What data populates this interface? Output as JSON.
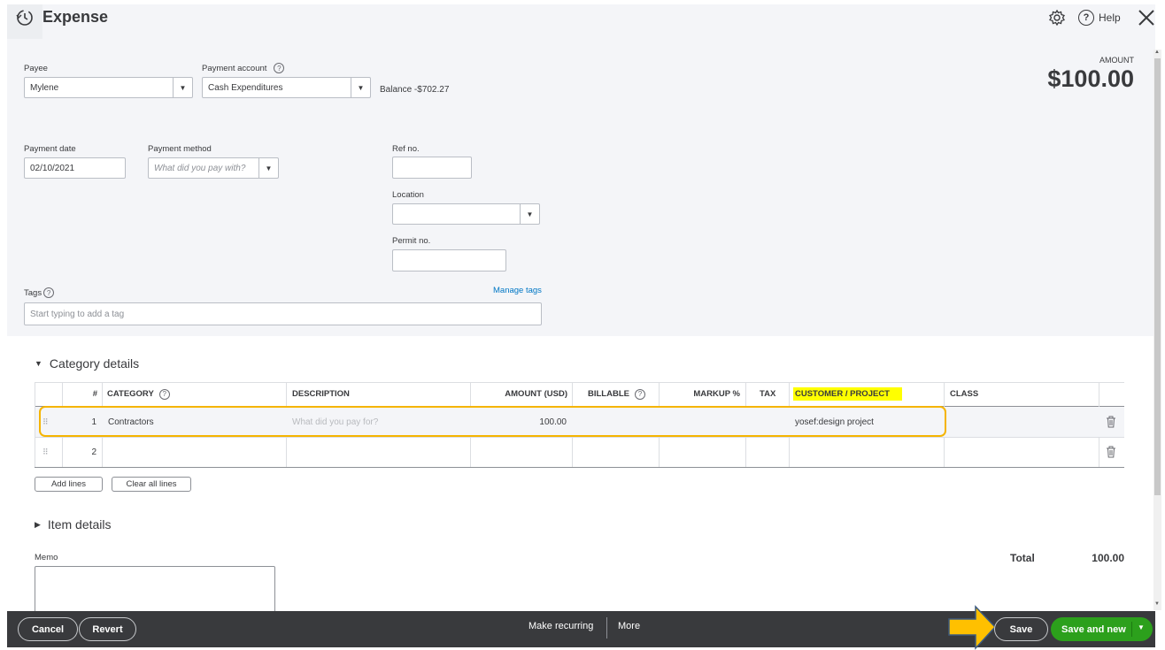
{
  "header": {
    "title": "Expense",
    "help_label": "Help"
  },
  "amount": {
    "label": "AMOUNT",
    "value": "$100.00"
  },
  "payee": {
    "label": "Payee",
    "value": "Mylene"
  },
  "payment_account": {
    "label": "Payment account",
    "value": "Cash Expenditures",
    "balance_label": "Balance",
    "balance_value": "-$702.27"
  },
  "payment_date": {
    "label": "Payment date",
    "value": "02/10/2021"
  },
  "payment_method": {
    "label": "Payment method",
    "placeholder": "What did you pay with?"
  },
  "ref_no": {
    "label": "Ref no."
  },
  "location": {
    "label": "Location"
  },
  "permit_no": {
    "label": "Permit no."
  },
  "tags": {
    "label": "Tags",
    "manage_label": "Manage tags",
    "placeholder": "Start typing to add a tag"
  },
  "category_details": {
    "title": "Category details",
    "columns": {
      "num": "#",
      "category": "CATEGORY",
      "description": "DESCRIPTION",
      "amount": "AMOUNT (USD)",
      "billable": "BILLABLE",
      "markup": "MARKUP %",
      "tax": "TAX",
      "customer": "CUSTOMER / PROJECT",
      "class": "CLASS"
    },
    "rows": [
      {
        "num": "1",
        "category": "Contractors",
        "description_placeholder": "What did you pay for?",
        "amount": "100.00",
        "customer": "yosef:design project"
      },
      {
        "num": "2"
      }
    ],
    "add_lines_label": "Add lines",
    "clear_lines_label": "Clear all lines"
  },
  "item_details": {
    "title": "Item details"
  },
  "memo": {
    "label": "Memo"
  },
  "total": {
    "label": "Total",
    "value": "100.00"
  },
  "footer": {
    "cancel_label": "Cancel",
    "revert_label": "Revert",
    "recurring_label": "Make recurring",
    "more_label": "More",
    "save_label": "Save",
    "save_new_label": "Save and new"
  },
  "colors": {
    "highlight": "#ffff00",
    "annotation_outline": "#f5b400",
    "save_green": "#2ca01c",
    "bar_dark": "#393a3d"
  }
}
